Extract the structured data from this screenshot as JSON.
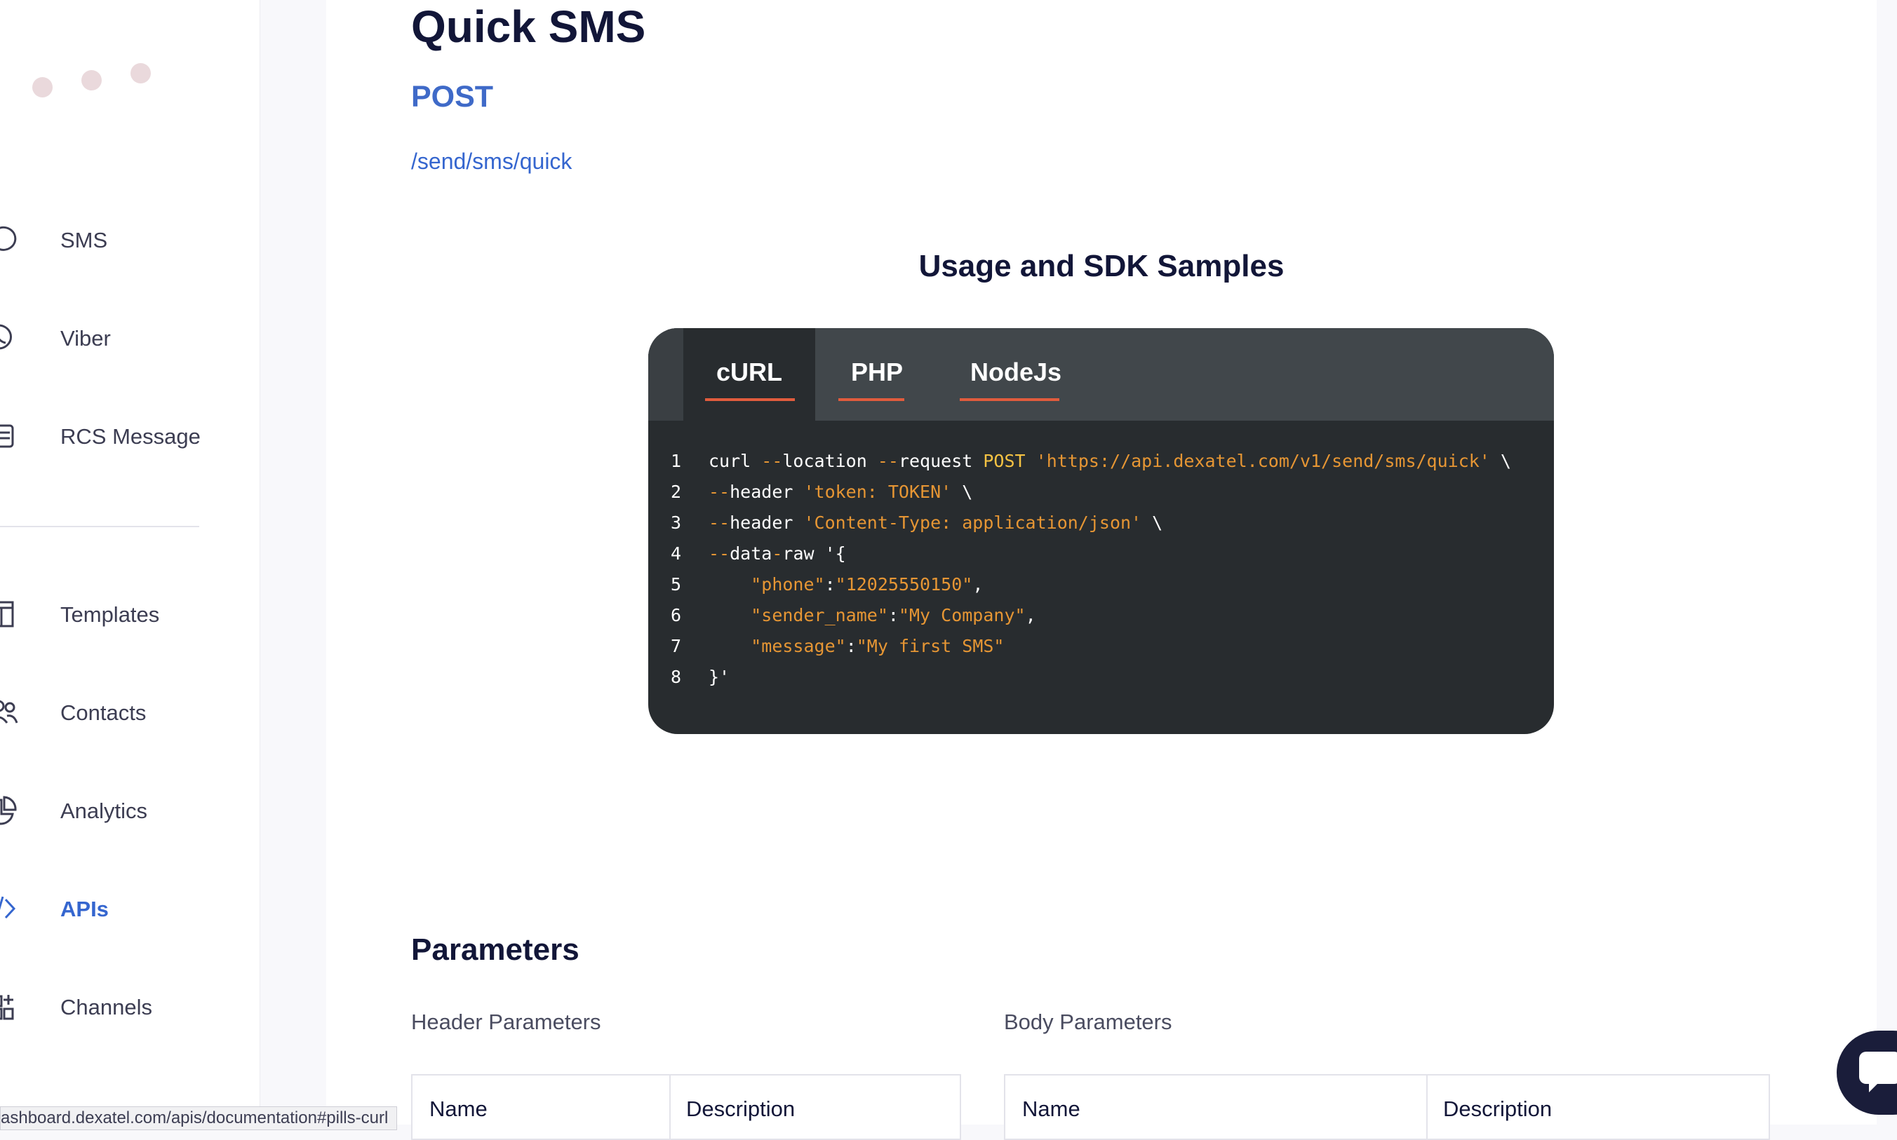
{
  "sidebar": {
    "items": [
      {
        "label": "SMS",
        "icon": "chat-bubble-icon"
      },
      {
        "label": "Viber",
        "icon": "viber-icon"
      },
      {
        "label": "RCS Message",
        "icon": "rcs-message-icon"
      },
      {
        "label": "Templates",
        "icon": "templates-icon"
      },
      {
        "label": "Contacts",
        "icon": "contacts-icon"
      },
      {
        "label": "Analytics",
        "icon": "analytics-icon"
      },
      {
        "label": "APIs",
        "icon": "code-icon"
      },
      {
        "label": "Channels",
        "icon": "channels-icon"
      }
    ],
    "active": "APIs"
  },
  "main": {
    "title": "Quick SMS",
    "method": "POST",
    "endpoint": "/send/sms/quick",
    "samples_title": "Usage and SDK Samples",
    "tabs": [
      {
        "label": "cURL",
        "active": true
      },
      {
        "label": "PHP",
        "active": false
      },
      {
        "label": "NodeJs",
        "active": false
      }
    ],
    "code_lines": [
      {
        "n": "1",
        "tokens": [
          {
            "t": "curl ",
            "c": "plain"
          },
          {
            "t": "--",
            "c": "dash"
          },
          {
            "t": "location ",
            "c": "plain"
          },
          {
            "t": "--",
            "c": "dash"
          },
          {
            "t": "request ",
            "c": "plain"
          },
          {
            "t": "POST",
            "c": "kw"
          },
          {
            "t": " ",
            "c": "plain"
          },
          {
            "t": "'https://api.dexatel.com/v1/send/sms/quick'",
            "c": "str"
          },
          {
            "t": " \\",
            "c": "plain"
          }
        ]
      },
      {
        "n": "2",
        "tokens": [
          {
            "t": "--",
            "c": "dash"
          },
          {
            "t": "header ",
            "c": "plain"
          },
          {
            "t": "'token: TOKEN'",
            "c": "str"
          },
          {
            "t": " \\",
            "c": "plain"
          }
        ]
      },
      {
        "n": "3",
        "tokens": [
          {
            "t": "--",
            "c": "dash"
          },
          {
            "t": "header ",
            "c": "plain"
          },
          {
            "t": "'Content-Type: application/json'",
            "c": "str"
          },
          {
            "t": " \\",
            "c": "plain"
          }
        ]
      },
      {
        "n": "4",
        "tokens": [
          {
            "t": "--",
            "c": "dash"
          },
          {
            "t": "data",
            "c": "plain"
          },
          {
            "t": "-",
            "c": "dash"
          },
          {
            "t": "raw '{",
            "c": "plain"
          }
        ]
      },
      {
        "n": "5",
        "tokens": [
          {
            "t": "    ",
            "c": "plain"
          },
          {
            "t": "\"phone\"",
            "c": "str"
          },
          {
            "t": ":",
            "c": "plain"
          },
          {
            "t": "\"12025550150\"",
            "c": "str"
          },
          {
            "t": ",",
            "c": "plain"
          }
        ]
      },
      {
        "n": "6",
        "tokens": [
          {
            "t": "    ",
            "c": "plain"
          },
          {
            "t": "\"sender_name\"",
            "c": "str"
          },
          {
            "t": ":",
            "c": "plain"
          },
          {
            "t": "\"My Company\"",
            "c": "str"
          },
          {
            "t": ",",
            "c": "plain"
          }
        ]
      },
      {
        "n": "7",
        "tokens": [
          {
            "t": "    ",
            "c": "plain"
          },
          {
            "t": "\"message\"",
            "c": "str"
          },
          {
            "t": ":",
            "c": "plain"
          },
          {
            "t": "\"My first SMS\"",
            "c": "str"
          }
        ]
      },
      {
        "n": "8",
        "tokens": [
          {
            "t": "}'",
            "c": "plain"
          }
        ]
      }
    ],
    "parameters_title": "Parameters",
    "header_params_title": "Header Parameters",
    "body_params_title": "Body Parameters",
    "header_table_columns": [
      "Name",
      "Description"
    ],
    "body_table_columns": [
      "Name",
      "Description"
    ]
  },
  "status_bar_url": "ashboard.dexatel.com/apis/documentation#pills-curl",
  "colors": {
    "accent": "#3566cf",
    "code_bg": "#282c2f",
    "tab_bar_bg": "#41474b",
    "tab_underline": "#e15c3d",
    "code_string": "#e69634",
    "code_keyword": "#f6c343",
    "heading": "#121638"
  },
  "chat_widget_icon": "chat-icon"
}
